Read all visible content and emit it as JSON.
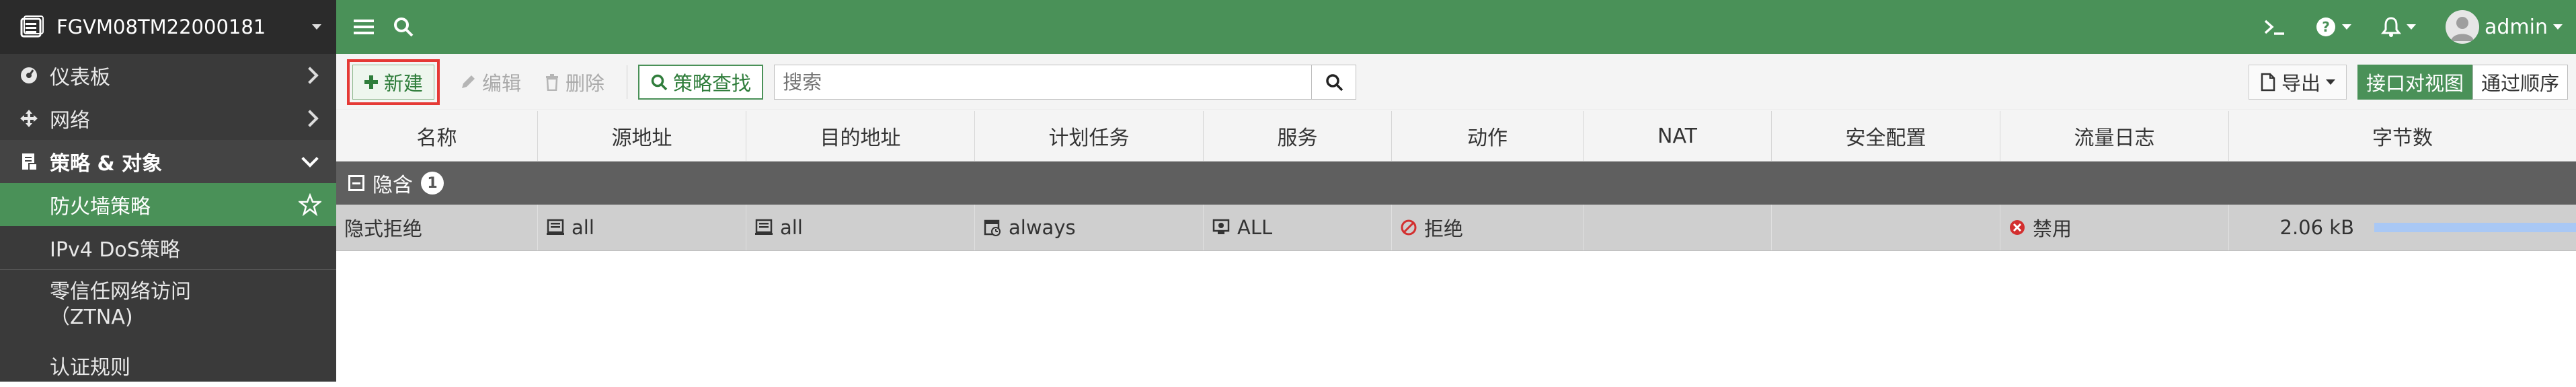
{
  "sidebar": {
    "device_name": "FGVM08TM22000181",
    "items": [
      {
        "label": "仪表板",
        "icon": "dashboard-icon"
      },
      {
        "label": "网络",
        "icon": "network-move-icon"
      },
      {
        "label": "策略 & 对象",
        "icon": "policy-objects-icon"
      }
    ],
    "subitems": [
      {
        "label": "防火墙策略"
      },
      {
        "label": "IPv4 DoS策略"
      },
      {
        "label": "零信任网络访问\n（ZTNA)"
      },
      {
        "label": "认证规则"
      }
    ]
  },
  "topbar": {
    "user": "admin"
  },
  "toolbar": {
    "new_label": "新建",
    "edit_label": "编辑",
    "delete_label": "删除",
    "policy_lookup_label": "策略查找",
    "search_placeholder": "搜索",
    "export_label": "导出",
    "view_interface_pair": "接口对视图",
    "view_by_sequence": "通过顺序"
  },
  "table": {
    "columns": [
      "名称",
      "源地址",
      "目的地址",
      "计划任务",
      "服务",
      "动作",
      "NAT",
      "安全配置",
      "流量日志",
      "字节数"
    ],
    "group": {
      "label": "隐含",
      "count": "1"
    },
    "rows": [
      {
        "name": "隐式拒绝",
        "source": "all",
        "destination": "all",
        "schedule": "always",
        "service": "ALL",
        "action": "拒绝",
        "nat": "",
        "security_profiles": "",
        "log": "禁用",
        "bytes": "2.06 kB"
      }
    ]
  },
  "colors": {
    "accent_green": "#4a9158",
    "sidebar_bg": "#3a3a3a",
    "deny_red": "#d32f2f",
    "highlight_red": "#e53935"
  }
}
